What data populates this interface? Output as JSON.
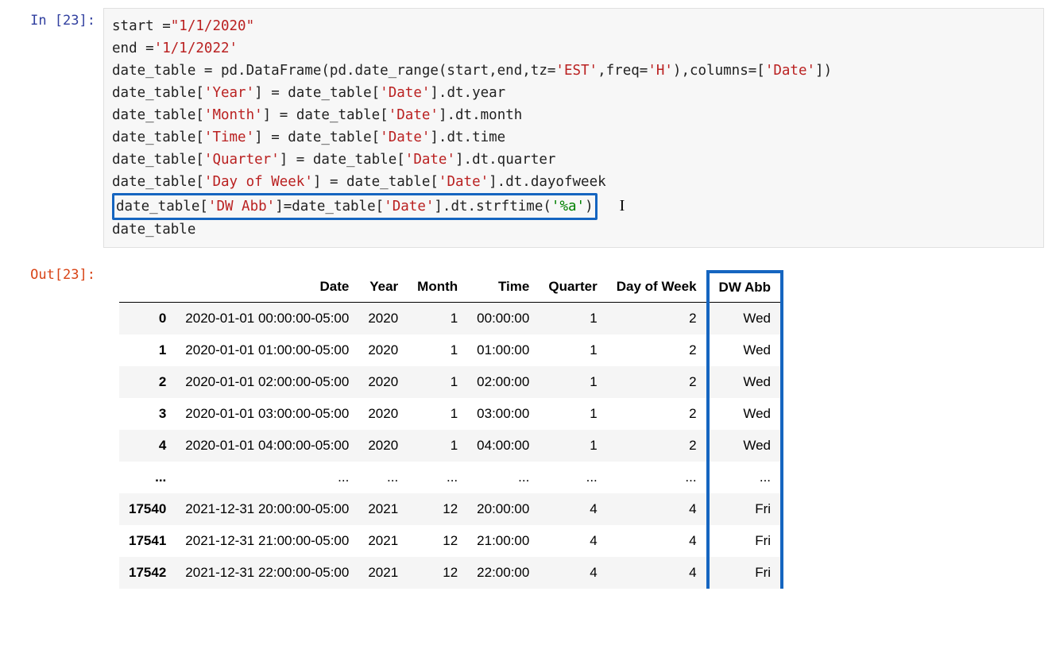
{
  "execution_count": "23",
  "prompts": {
    "in": "In [23]:",
    "out": "Out[23]:"
  },
  "code": {
    "l1_a": "start =",
    "l1_b": "\"1/1/2020\"",
    "l2_a": "end =",
    "l2_b": "'1/1/2022'",
    "l3_a": "date_table = pd.DataFrame(pd.date_range(start,end,tz=",
    "l3_b": "'EST'",
    "l3_c": ",freq=",
    "l3_d": "'H'",
    "l3_e": "),columns=[",
    "l3_f": "'Date'",
    "l3_g": "])",
    "l4_a": "date_table[",
    "l4_b": "'Year'",
    "l4_c": "] = date_table[",
    "l4_d": "'Date'",
    "l4_e": "].dt.year",
    "l5_a": "date_table[",
    "l5_b": "'Month'",
    "l5_c": "] = date_table[",
    "l5_d": "'Date'",
    "l5_e": "].dt.month",
    "l6_a": "date_table[",
    "l6_b": "'Time'",
    "l6_c": "] = date_table[",
    "l6_d": "'Date'",
    "l6_e": "].dt.time",
    "l7_a": "date_table[",
    "l7_b": "'Quarter'",
    "l7_c": "] = date_table[",
    "l7_d": "'Date'",
    "l7_e": "].dt.quarter",
    "l8_a": "date_table[",
    "l8_b": "'Day of Week'",
    "l8_c": "] = date_table[",
    "l8_d": "'Date'",
    "l8_e": "].dt.dayofweek",
    "l9_a": "date_table[",
    "l9_b": "'DW Abb'",
    "l9_c": "]=date_table[",
    "l9_d": "'Date'",
    "l9_e": "].dt.strftime(",
    "l9_f": "'%a'",
    "l9_g": ")",
    "l10": "date_table"
  },
  "columns": [
    "Date",
    "Year",
    "Month",
    "Time",
    "Quarter",
    "Day of Week",
    "DW Abb"
  ],
  "rows": [
    {
      "idx": "0",
      "Date": "2020-01-01 00:00:00-05:00",
      "Year": "2020",
      "Month": "1",
      "Time": "00:00:00",
      "Quarter": "1",
      "DayOfWeek": "2",
      "DWAbb": "Wed"
    },
    {
      "idx": "1",
      "Date": "2020-01-01 01:00:00-05:00",
      "Year": "2020",
      "Month": "1",
      "Time": "01:00:00",
      "Quarter": "1",
      "DayOfWeek": "2",
      "DWAbb": "Wed"
    },
    {
      "idx": "2",
      "Date": "2020-01-01 02:00:00-05:00",
      "Year": "2020",
      "Month": "1",
      "Time": "02:00:00",
      "Quarter": "1",
      "DayOfWeek": "2",
      "DWAbb": "Wed"
    },
    {
      "idx": "3",
      "Date": "2020-01-01 03:00:00-05:00",
      "Year": "2020",
      "Month": "1",
      "Time": "03:00:00",
      "Quarter": "1",
      "DayOfWeek": "2",
      "DWAbb": "Wed"
    },
    {
      "idx": "4",
      "Date": "2020-01-01 04:00:00-05:00",
      "Year": "2020",
      "Month": "1",
      "Time": "04:00:00",
      "Quarter": "1",
      "DayOfWeek": "2",
      "DWAbb": "Wed"
    },
    {
      "idx": "...",
      "Date": "...",
      "Year": "...",
      "Month": "...",
      "Time": "...",
      "Quarter": "...",
      "DayOfWeek": "...",
      "DWAbb": "..."
    },
    {
      "idx": "17540",
      "Date": "2021-12-31 20:00:00-05:00",
      "Year": "2021",
      "Month": "12",
      "Time": "20:00:00",
      "Quarter": "4",
      "DayOfWeek": "4",
      "DWAbb": "Fri"
    },
    {
      "idx": "17541",
      "Date": "2021-12-31 21:00:00-05:00",
      "Year": "2021",
      "Month": "12",
      "Time": "21:00:00",
      "Quarter": "4",
      "DayOfWeek": "4",
      "DWAbb": "Fri"
    },
    {
      "idx": "17542",
      "Date": "2021-12-31 22:00:00-05:00",
      "Year": "2021",
      "Month": "12",
      "Time": "22:00:00",
      "Quarter": "4",
      "DayOfWeek": "4",
      "DWAbb": "Fri"
    }
  ]
}
